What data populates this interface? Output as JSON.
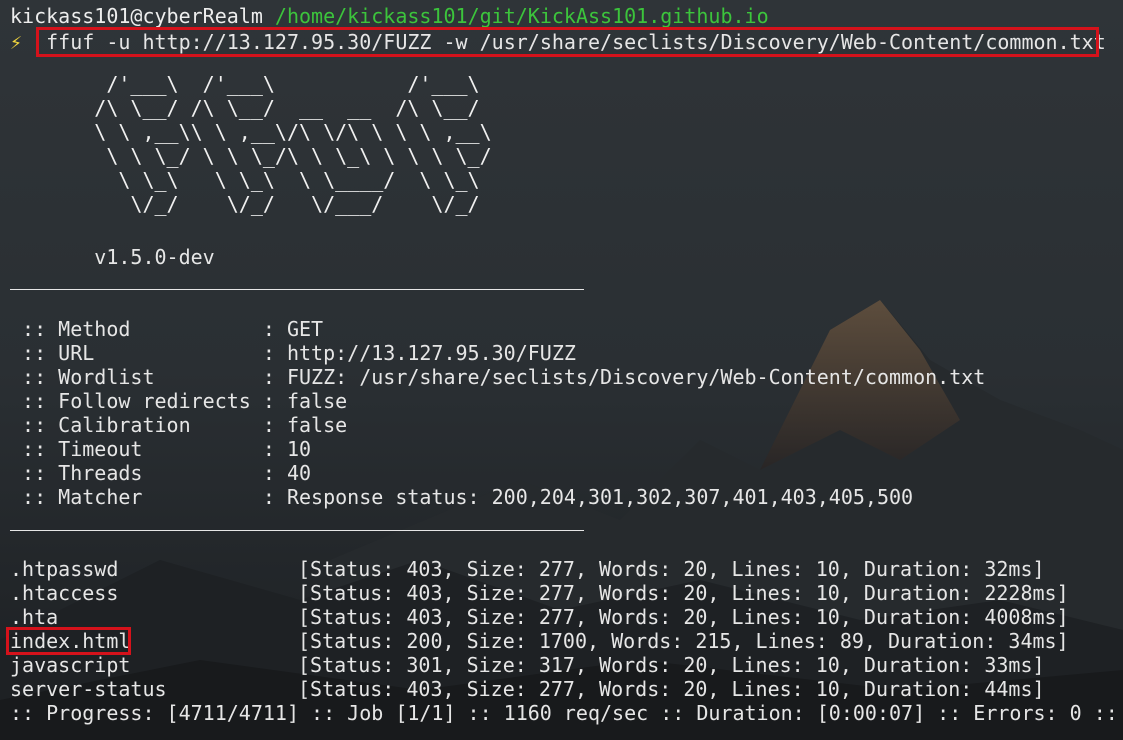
{
  "prompt": {
    "user_host": "kickass101@cyberRealm",
    "path": "/home/kickass101/git/KickAss101.github.io",
    "symbol": "⚡",
    "command": "ffuf -u http://13.127.95.30/FUZZ -w /usr/share/seclists/Discovery/Web-Content/common.txt"
  },
  "banner": {
    "ascii_art": "        /'___\\  /'___\\           /'___\\\n       /\\ \\__/ /\\ \\__/  __  __  /\\ \\__/\n       \\ \\ ,__\\\\ \\ ,__\\/\\ \\/\\ \\ \\ \\ ,__\\\n        \\ \\ \\_/ \\ \\ \\_/\\ \\ \\_\\ \\ \\ \\ \\_/\n         \\ \\_\\   \\ \\_\\  \\ \\____/  \\ \\_\\\n          \\/_/    \\/_/   \\/___/    \\/_/",
    "version": "       v1.5.0-dev"
  },
  "config": [
    " :: Method           : GET",
    " :: URL              : http://13.127.95.30/FUZZ",
    " :: Wordlist         : FUZZ: /usr/share/seclists/Discovery/Web-Content/common.txt",
    " :: Follow redirects : false",
    " :: Calibration      : false",
    " :: Timeout          : 10",
    " :: Threads          : 40",
    " :: Matcher          : Response status: 200,204,301,302,307,401,403,405,500"
  ],
  "results": [
    {
      "name": ".htpasswd",
      "detail": "[Status: 403, Size: 277, Words: 20, Lines: 10, Duration: 32ms]"
    },
    {
      "name": ".htaccess",
      "detail": "[Status: 403, Size: 277, Words: 20, Lines: 10, Duration: 2228ms]"
    },
    {
      "name": ".hta",
      "detail": "[Status: 403, Size: 277, Words: 20, Lines: 10, Duration: 4008ms]"
    },
    {
      "name": "index.html",
      "detail": "[Status: 200, Size: 1700, Words: 215, Lines: 89, Duration: 34ms]"
    },
    {
      "name": "javascript",
      "detail": "[Status: 301, Size: 317, Words: 20, Lines: 10, Duration: 33ms]"
    },
    {
      "name": "server-status",
      "detail": "[Status: 403, Size: 277, Words: 20, Lines: 10, Duration: 44ms]"
    }
  ],
  "progress": ":: Progress: [4711/4711] :: Job [1/1] :: 1160 req/sec :: Duration: [0:00:07] :: Errors: 0 ::"
}
